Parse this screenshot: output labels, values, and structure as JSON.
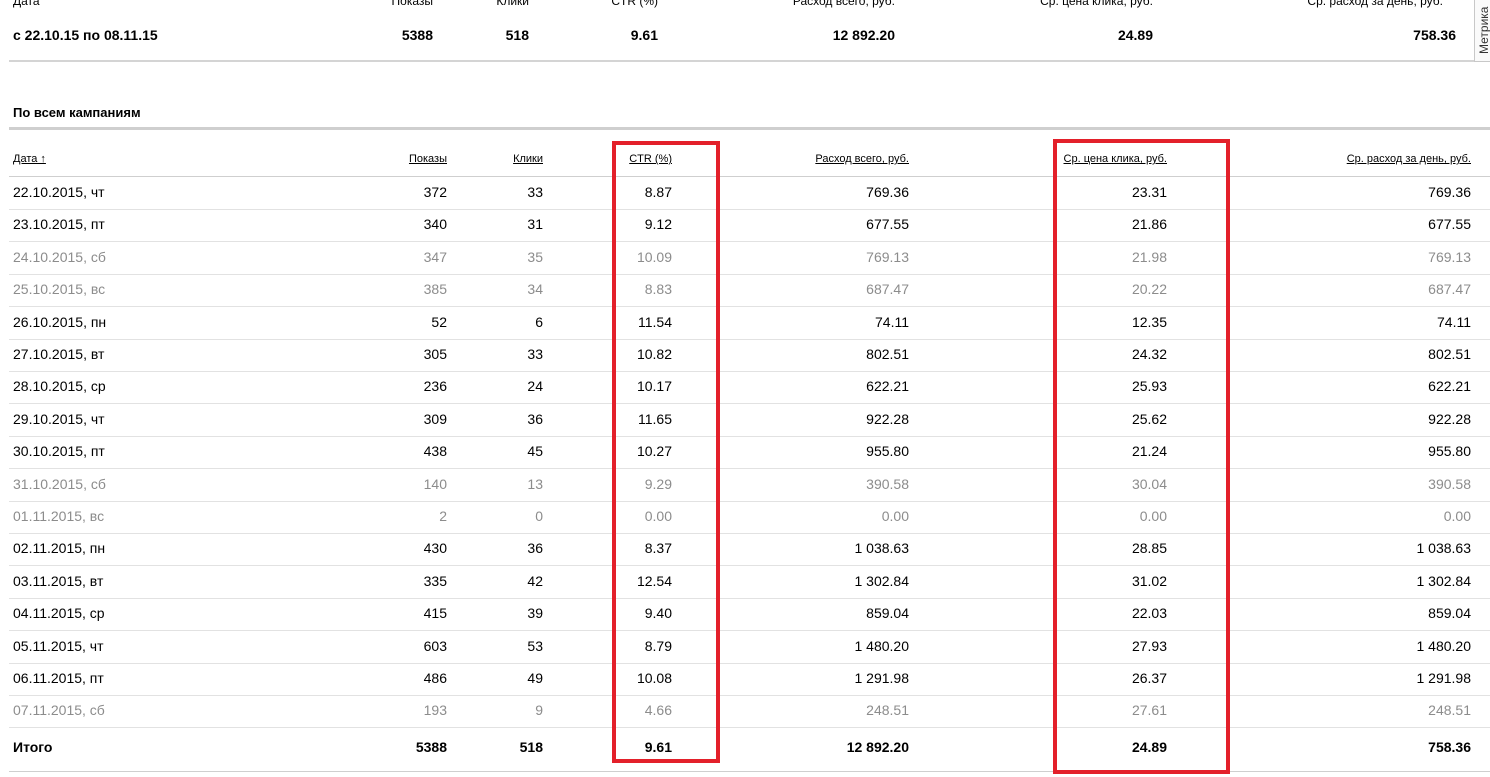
{
  "summary": {
    "headers": [
      "Дата",
      "Показы",
      "Клики",
      "CTR (%)",
      "Расход всего, руб.",
      "Ср. цена клика, руб.",
      "Ср. расход за день, руб."
    ],
    "period": "с 22.10.15 по 08.11.15",
    "shows": "5388",
    "clicks": "518",
    "ctr": "9.61",
    "spend": "12 892.20",
    "cpc": "24.89",
    "daily": "758.36"
  },
  "sidebar_tab": "Метрика",
  "section_title": "По всем кампаниям",
  "table": {
    "headers": [
      "Дата ↑",
      "Показы",
      "Клики",
      "CTR (%)",
      "Расход всего, руб.",
      "Ср. цена клика, руб.",
      "Ср. расход за день, руб."
    ],
    "rows": [
      {
        "date": "22.10.2015, чт",
        "shows": "372",
        "clicks": "33",
        "ctr": "8.87",
        "spend": "769.36",
        "cpc": "23.31",
        "daily": "769.36",
        "weekend": false
      },
      {
        "date": "23.10.2015, пт",
        "shows": "340",
        "clicks": "31",
        "ctr": "9.12",
        "spend": "677.55",
        "cpc": "21.86",
        "daily": "677.55",
        "weekend": false
      },
      {
        "date": "24.10.2015, сб",
        "shows": "347",
        "clicks": "35",
        "ctr": "10.09",
        "spend": "769.13",
        "cpc": "21.98",
        "daily": "769.13",
        "weekend": true
      },
      {
        "date": "25.10.2015, вс",
        "shows": "385",
        "clicks": "34",
        "ctr": "8.83",
        "spend": "687.47",
        "cpc": "20.22",
        "daily": "687.47",
        "weekend": true
      },
      {
        "date": "26.10.2015, пн",
        "shows": "52",
        "clicks": "6",
        "ctr": "11.54",
        "spend": "74.11",
        "cpc": "12.35",
        "daily": "74.11",
        "weekend": false
      },
      {
        "date": "27.10.2015, вт",
        "shows": "305",
        "clicks": "33",
        "ctr": "10.82",
        "spend": "802.51",
        "cpc": "24.32",
        "daily": "802.51",
        "weekend": false
      },
      {
        "date": "28.10.2015, ср",
        "shows": "236",
        "clicks": "24",
        "ctr": "10.17",
        "spend": "622.21",
        "cpc": "25.93",
        "daily": "622.21",
        "weekend": false
      },
      {
        "date": "29.10.2015, чт",
        "shows": "309",
        "clicks": "36",
        "ctr": "11.65",
        "spend": "922.28",
        "cpc": "25.62",
        "daily": "922.28",
        "weekend": false
      },
      {
        "date": "30.10.2015, пт",
        "shows": "438",
        "clicks": "45",
        "ctr": "10.27",
        "spend": "955.80",
        "cpc": "21.24",
        "daily": "955.80",
        "weekend": false
      },
      {
        "date": "31.10.2015, сб",
        "shows": "140",
        "clicks": "13",
        "ctr": "9.29",
        "spend": "390.58",
        "cpc": "30.04",
        "daily": "390.58",
        "weekend": true
      },
      {
        "date": "01.11.2015, вс",
        "shows": "2",
        "clicks": "0",
        "ctr": "0.00",
        "spend": "0.00",
        "cpc": "0.00",
        "daily": "0.00",
        "weekend": true
      },
      {
        "date": "02.11.2015, пн",
        "shows": "430",
        "clicks": "36",
        "ctr": "8.37",
        "spend": "1 038.63",
        "cpc": "28.85",
        "daily": "1 038.63",
        "weekend": false
      },
      {
        "date": "03.11.2015, вт",
        "shows": "335",
        "clicks": "42",
        "ctr": "12.54",
        "spend": "1 302.84",
        "cpc": "31.02",
        "daily": "1 302.84",
        "weekend": false
      },
      {
        "date": "04.11.2015, ср",
        "shows": "415",
        "clicks": "39",
        "ctr": "9.40",
        "spend": "859.04",
        "cpc": "22.03",
        "daily": "859.04",
        "weekend": false
      },
      {
        "date": "05.11.2015, чт",
        "shows": "603",
        "clicks": "53",
        "ctr": "8.79",
        "spend": "1 480.20",
        "cpc": "27.93",
        "daily": "1 480.20",
        "weekend": false
      },
      {
        "date": "06.11.2015, пт",
        "shows": "486",
        "clicks": "49",
        "ctr": "10.08",
        "spend": "1 291.98",
        "cpc": "26.37",
        "daily": "1 291.98",
        "weekend": false
      },
      {
        "date": "07.11.2015, сб",
        "shows": "193",
        "clicks": "9",
        "ctr": "4.66",
        "spend": "248.51",
        "cpc": "27.61",
        "daily": "248.51",
        "weekend": true
      }
    ],
    "totals": {
      "label": "Итого",
      "shows": "5388",
      "clicks": "518",
      "ctr": "9.61",
      "spend": "12 892.20",
      "cpc": "24.89",
      "daily": "758.36"
    }
  },
  "colors": {
    "highlight": "#e3202a",
    "weekend_text": "#8c8c8c"
  }
}
